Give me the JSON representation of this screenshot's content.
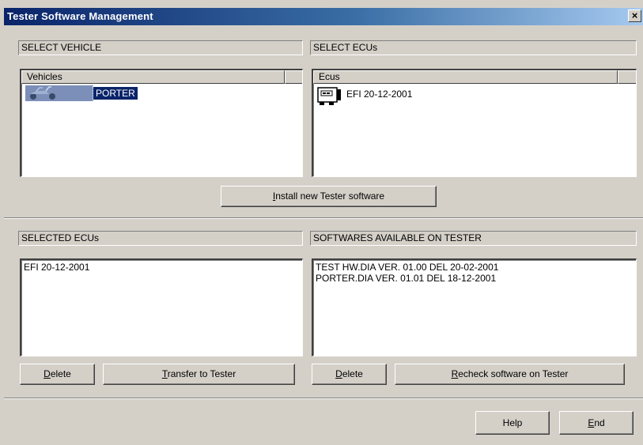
{
  "window": {
    "title": "Tester Software Management",
    "close_glyph": "×"
  },
  "select_vehicle": {
    "label": "SELECT VEHICLE",
    "column": "Vehicles",
    "items": [
      {
        "name": "PORTER",
        "selected": true,
        "icon": "scooter-icon"
      }
    ]
  },
  "select_ecus": {
    "label": "SELECT ECUs",
    "column": "Ecus",
    "items": [
      {
        "name": "EFI 20-12-2001",
        "icon": "ecu-icon"
      }
    ]
  },
  "install_button": {
    "underline": "I",
    "rest": "nstall new Tester software"
  },
  "selected_ecus": {
    "label": "SELECTED ECUs",
    "items": [
      "EFI 20-12-2001"
    ]
  },
  "softwares": {
    "label": "SOFTWARES AVAILABLE ON TESTER",
    "items": [
      "TEST HW.DIA VER. 01.00 DEL 20-02-2001",
      "PORTER.DIA VER. 01.01 DEL 18-12-2001"
    ]
  },
  "buttons": {
    "delete_left": {
      "underline": "D",
      "rest": "elete"
    },
    "transfer": {
      "underline": "T",
      "rest": "ransfer to Tester"
    },
    "delete_right": {
      "underline": "D",
      "rest": "elete"
    },
    "recheck": {
      "underline": "R",
      "rest": "echeck software on Tester"
    },
    "help": {
      "label": "Help"
    },
    "end": {
      "underline": "E",
      "rest": "nd"
    }
  },
  "colors": {
    "selection": "#0a246a",
    "face": "#d4d0c8",
    "title_start": "#0a246a",
    "title_end": "#a6caf0"
  }
}
